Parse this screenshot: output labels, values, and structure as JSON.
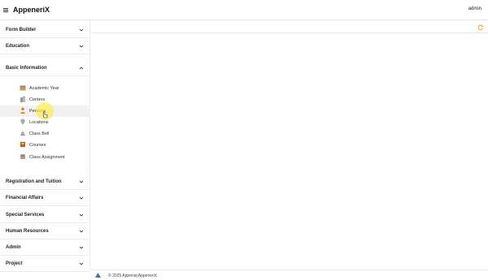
{
  "header": {
    "brand": "AppeneriX",
    "user": "admin"
  },
  "sidebar": {
    "sections_top": [
      {
        "label": "Form Builder",
        "expanded": false
      },
      {
        "label": "Education",
        "expanded": false
      },
      {
        "label": "Basic Information",
        "expanded": true
      }
    ],
    "basic_info_items": [
      {
        "label": "Academic Year",
        "icon": "calendar-icon"
      },
      {
        "label": "Centers",
        "icon": "building-icon"
      },
      {
        "label": "Persons",
        "icon": "person-icon"
      },
      {
        "label": "Locations",
        "icon": "map-pin-icon"
      },
      {
        "label": "Class Bell",
        "icon": "bell-icon"
      },
      {
        "label": "Courses",
        "icon": "book-icon"
      },
      {
        "label": "Class Assignment",
        "icon": "assignment-icon"
      }
    ],
    "sections_bottom": [
      {
        "label": "Registration and Tuition",
        "expanded": false
      },
      {
        "label": "Financial Affairs",
        "expanded": false
      },
      {
        "label": "Special Services",
        "expanded": false
      },
      {
        "label": "Human Resources",
        "expanded": false
      },
      {
        "label": "Admin",
        "expanded": false
      },
      {
        "label": "Project",
        "expanded": false
      }
    ]
  },
  "footer": {
    "copyright": "© 2025 Appeniq AppeneriX"
  },
  "colors": {
    "accent": "#e6a21a",
    "divider": "#ececec",
    "hover": "#f1f1f1",
    "highlight": "#ffec50"
  }
}
